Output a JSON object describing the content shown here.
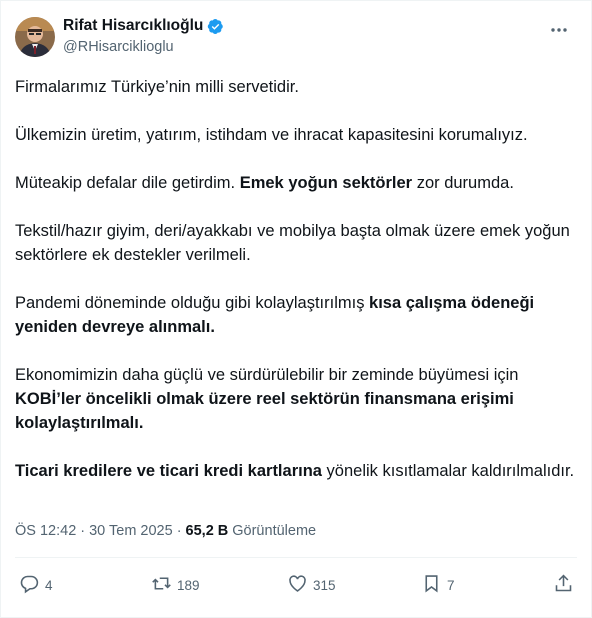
{
  "author": {
    "display_name": "Rifat Hisarcıklıoğlu",
    "handle": "@RHisarciklioglu",
    "verified_color": "#1d9bf0"
  },
  "tweet": {
    "p1": "Firmalarımız Türkiye’nin milli servetidir.",
    "p2": "Ülkemizin üretim, yatırım, istihdam ve ihracat kapasitesini korumalıyız.",
    "p3_a": "Müteakip defalar dile getirdim. ",
    "p3_b": "Emek yoğun sektörler",
    "p3_c": " zor durumda.",
    "p4": "Tekstil/hazır giyim, deri/ayakkabı ve mobilya başta olmak üzere emek yoğun sektörlere ek destekler verilmeli.",
    "p5_a": "Pandemi döneminde olduğu gibi kolaylaştırılmış ",
    "p5_b": "kısa çalışma ödeneği yeniden devreye alınmalı.",
    "p6_a": "Ekonomimizin daha güçlü ve sürdürülebilir bir zeminde büyümesi için ",
    "p6_b": "KOBİ’ler öncelikli olmak üzere reel sektörün finansmana erişimi kolaylaştırılmalı.",
    "p7_a": "Ticari kredilere ve ticari kredi kartlarına",
    "p7_b": " yönelik kısıtlamalar kaldırılmalıdır."
  },
  "meta": {
    "time": "ÖS 12:42",
    "separator": "·",
    "date": "30 Tem 2025",
    "views_count": "65,2 B",
    "views_label": "Görüntüleme"
  },
  "actions": {
    "replies": "4",
    "reposts": "189",
    "likes": "315",
    "bookmarks": "7"
  },
  "icons": {
    "reply": "reply-icon",
    "repost": "repost-icon",
    "like": "heart-icon",
    "bookmark": "bookmark-icon",
    "share": "share-icon",
    "more": "more-icon",
    "verified": "verified-badge-icon"
  }
}
